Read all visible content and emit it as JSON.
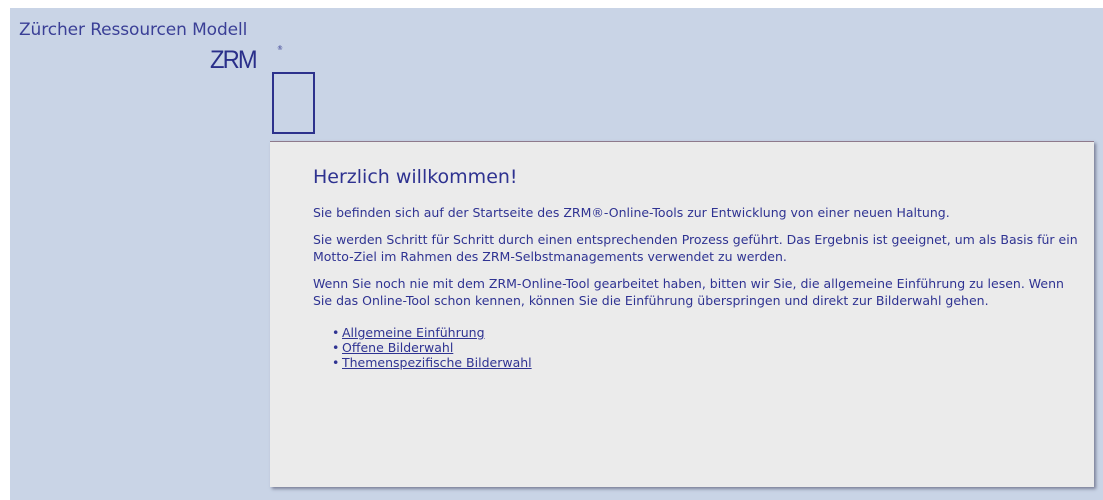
{
  "header": {
    "title": "Zürcher Ressourcen Modell",
    "logo_text": "ZRM",
    "logo_registered": "®"
  },
  "welcome": {
    "heading": "Herzlich willkommen!",
    "paragraph1": "Sie befinden sich auf der Startseite des ZRM®-Online-Tools zur Entwicklung von einer neuen Haltung.",
    "paragraph2": "Sie werden Schritt für Schritt durch einen entsprechenden Prozess geführt. Das Ergebnis ist geeignet, um als Basis für ein Motto-Ziel im Rahmen des ZRM-Selbstmanagements verwendet zu werden.",
    "paragraph3": "Wenn Sie noch nie mit dem ZRM-Online-Tool gearbeitet haben, bitten wir Sie, die allgemeine Einführung zu lesen. Wenn Sie das Online-Tool schon kennen, können Sie die Einführung überspringen und direkt zur Bilderwahl gehen.",
    "links": [
      {
        "label": "Allgemeine Einführung"
      },
      {
        "label": "Offene Bilderwahl"
      },
      {
        "label": "Themenspezifische Bilderwahl"
      }
    ]
  },
  "colors": {
    "background": "#c9d4e6",
    "panel": "#ebebeb",
    "text": "#2f3392"
  }
}
